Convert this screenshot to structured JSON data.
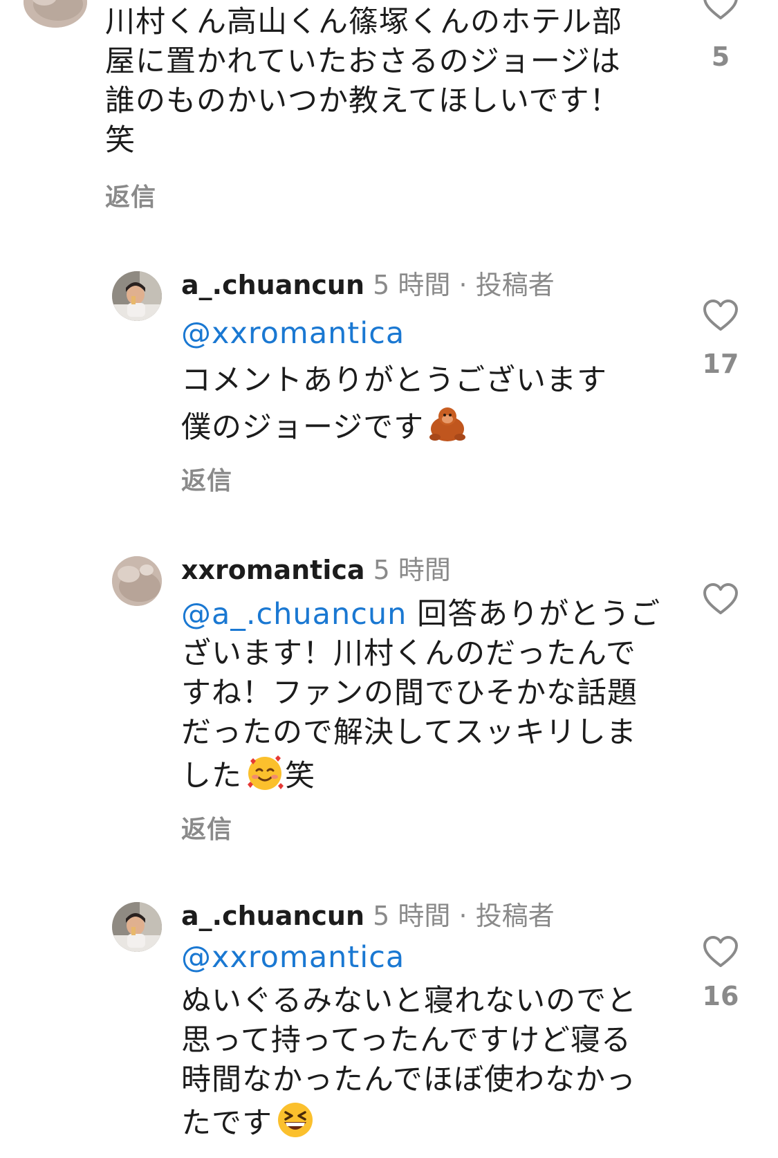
{
  "comments": [
    {
      "lines": [
        "川村くん高山くん篠塚くんのホテル部",
        "屋に置かれていたおさるのジョージは",
        "誰のものかいつか教えてほしいです！",
        "笑"
      ],
      "reply_label": "返信",
      "like_count": "5"
    },
    {
      "username": "a_.chuancun",
      "time": "5 時間",
      "separator": "·",
      "author_tag": "投稿者",
      "mention": "@xxromantica",
      "lines": [
        "コメントありがとうございます",
        "僕のジョージです"
      ],
      "emoji": "orangutan",
      "reply_label": "返信",
      "like_count": "17"
    },
    {
      "username": "xxromantica",
      "time": "5 時間",
      "mention": "@a_.chuancun",
      "first_line_rest": " 回答ありがとうご",
      "lines": [
        "ざいます！川村くんのだったんで",
        "すね！ファンの間でひそかな話題",
        "だったので解決してスッキリしま"
      ],
      "last_line_before_emoji": "した",
      "last_line_after_emoji": "笑",
      "emoji": "smiling-face-with-hearts",
      "reply_label": "返信"
    },
    {
      "username": "a_.chuancun",
      "time": "5 時間",
      "separator": "·",
      "author_tag": "投稿者",
      "mention": "@xxromantica",
      "lines": [
        "ぬいぐるみないと寝れないのでと",
        "思って持ってったんですけど寝る",
        "時間なかったんでほぼ使わなかっ"
      ],
      "last_line_before_emoji": "たです",
      "emoji": "grinning-squinting-face",
      "like_count": "16"
    }
  ],
  "colors": {
    "mention": "#1a78d2",
    "muted": "#8a8a8a",
    "text": "#1c1c1c"
  }
}
